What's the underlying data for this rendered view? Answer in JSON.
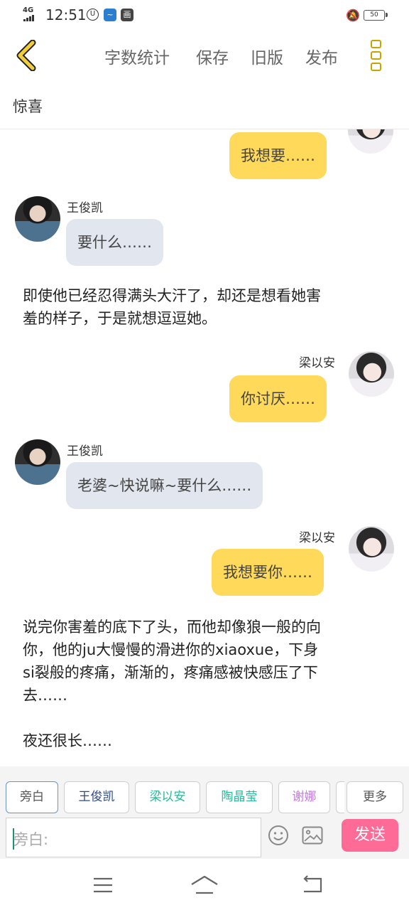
{
  "status_bar": {
    "network": "4G",
    "time": "12:51",
    "battery": "50"
  },
  "toolbar": {
    "word_count": "字数统计",
    "save": "保存",
    "old_version": "旧版",
    "publish": "发布"
  },
  "story_title": "惊喜",
  "messages": [
    {
      "role": "right",
      "name": "",
      "text": "我想要……"
    },
    {
      "role": "left",
      "name": "王俊凯",
      "text": "要什么……"
    },
    {
      "role": "narration",
      "lines": [
        "即使他已经忍得满头大汗了，却还是想看她害",
        "羞的样子，于是就想逗逗她。"
      ]
    },
    {
      "role": "right",
      "name": "梁以安",
      "text": "你讨厌……"
    },
    {
      "role": "left",
      "name": "王俊凯",
      "text": "老婆~快说嘛~要什么……"
    },
    {
      "role": "right",
      "name": "梁以安",
      "text": "我想要你……"
    },
    {
      "role": "narration",
      "lines": [
        "说完你害羞的底下了头，而他却像狼一般的向",
        "你，他的ju大慢慢的滑进你的xiaoxue，下身",
        "si裂般的疼痛，渐渐的，疼痛感被快感压了下",
        "去……",
        "",
        "夜还很长……"
      ]
    }
  ],
  "roles": [
    {
      "label": "旁白",
      "color": "#555555",
      "selected": true
    },
    {
      "label": "王俊凯",
      "color": "#2c4a86"
    },
    {
      "label": "梁以安",
      "color": "#2bb89a"
    },
    {
      "label": "陶晶莹",
      "color": "#2bb89a"
    },
    {
      "label": "谢娜",
      "color": "#c07ae0"
    }
  ],
  "more_label": "更多",
  "input": {
    "placeholder": "旁白:"
  },
  "send_label": "发送",
  "colors": {
    "accent_yellow": "#ffd95a",
    "bubble_gray": "#e2e6ef",
    "send_pink": "#fd6b96",
    "icon_gold": "#c9a300"
  }
}
